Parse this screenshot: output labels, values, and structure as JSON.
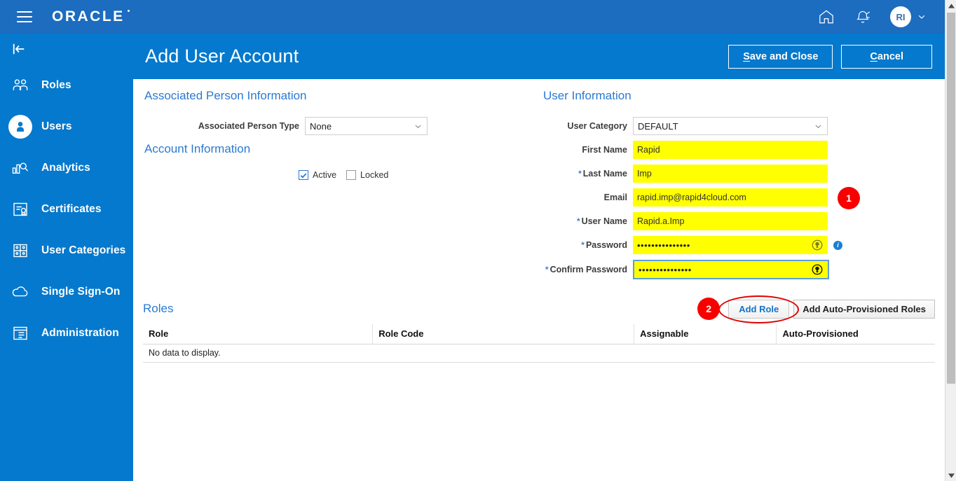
{
  "topbar": {
    "menu_icon": "hamburger-icon",
    "logo_text": "ORACLE",
    "home_icon": "home-icon",
    "notifications_icon": "bell-icon",
    "avatar_initials": "RI",
    "avatar_chevron_icon": "chevron-down-icon"
  },
  "sidebar": {
    "collapse_icon": "collapse-panel-icon",
    "items": [
      {
        "label": "Roles",
        "icon": "users-group-icon",
        "active": false
      },
      {
        "label": "Users",
        "icon": "user-person-icon",
        "active": true
      },
      {
        "label": "Analytics",
        "icon": "bar-chart-search-icon",
        "active": false
      },
      {
        "label": "Certificates",
        "icon": "certificate-icon",
        "active": false
      },
      {
        "label": "User Categories",
        "icon": "grid-people-icon",
        "active": false
      },
      {
        "label": "Single Sign-On",
        "icon": "cloud-icon",
        "active": false
      },
      {
        "label": "Administration",
        "icon": "list-window-icon",
        "active": false
      }
    ]
  },
  "page": {
    "title": "Add User Account",
    "save_label": "Save and Close",
    "save_accel": "S",
    "save_rest": "ave and Close",
    "cancel_label": "Cancel",
    "cancel_accel": "C",
    "cancel_rest": "ancel"
  },
  "associated_person": {
    "heading": "Associated Person Information",
    "person_type_label": "Associated Person Type",
    "person_type_value": "None",
    "person_type_options": [
      "None"
    ]
  },
  "account_info": {
    "heading": "Account Information",
    "active_label": "Active",
    "active_checked": true,
    "locked_label": "Locked",
    "locked_checked": false
  },
  "user_info": {
    "heading": "User Information",
    "fields": [
      {
        "label": "User Category",
        "value": "DEFAULT",
        "type": "select",
        "required": false,
        "highlight": false,
        "focused": false
      },
      {
        "label": "First Name",
        "value": "Rapid",
        "type": "text",
        "required": false,
        "highlight": true,
        "focused": false
      },
      {
        "label": "Last Name",
        "value": "Imp",
        "type": "text",
        "required": true,
        "highlight": true,
        "focused": false
      },
      {
        "label": "Email",
        "value": "rapid.imp@rapid4cloud.com",
        "type": "text",
        "required": false,
        "highlight": true,
        "focused": false
      },
      {
        "label": "User Name",
        "value": "Rapid.a.Imp",
        "type": "text",
        "required": true,
        "highlight": true,
        "focused": false
      },
      {
        "label": "Password",
        "value": "•••••••••••••••",
        "type": "password",
        "required": true,
        "highlight": true,
        "focused": false
      },
      {
        "label": "Confirm Password",
        "value": "•••••••••••••••",
        "type": "password",
        "required": true,
        "highlight": true,
        "focused": true
      }
    ],
    "user_category_options": [
      "DEFAULT"
    ],
    "password_generate_icon": "generate-password-icon",
    "password_info_icon": "info-icon"
  },
  "roles": {
    "heading": "Roles",
    "add_role_label": "Add Role",
    "add_auto_label": "Add Auto-Provisioned Roles",
    "columns": [
      "Role",
      "Role Code",
      "Assignable",
      "Auto-Provisioned"
    ],
    "rows": [],
    "empty_text": "No data to display."
  },
  "annotations": [
    {
      "number": "1",
      "target": "email-field"
    },
    {
      "number": "2",
      "target": "add-role-button"
    }
  ],
  "scrollbar": {
    "up_arrow_icon": "scroll-up-arrow-icon",
    "down_arrow_icon": "scroll-down-arrow-icon"
  },
  "colors": {
    "brand_top": "#1c6cc0",
    "brand_blue": "#0579cd",
    "section_heading": "#2a7ad2",
    "highlight_field": "#ffff00",
    "annotation_red": "#f90000",
    "link_blue": "#1573c6"
  }
}
